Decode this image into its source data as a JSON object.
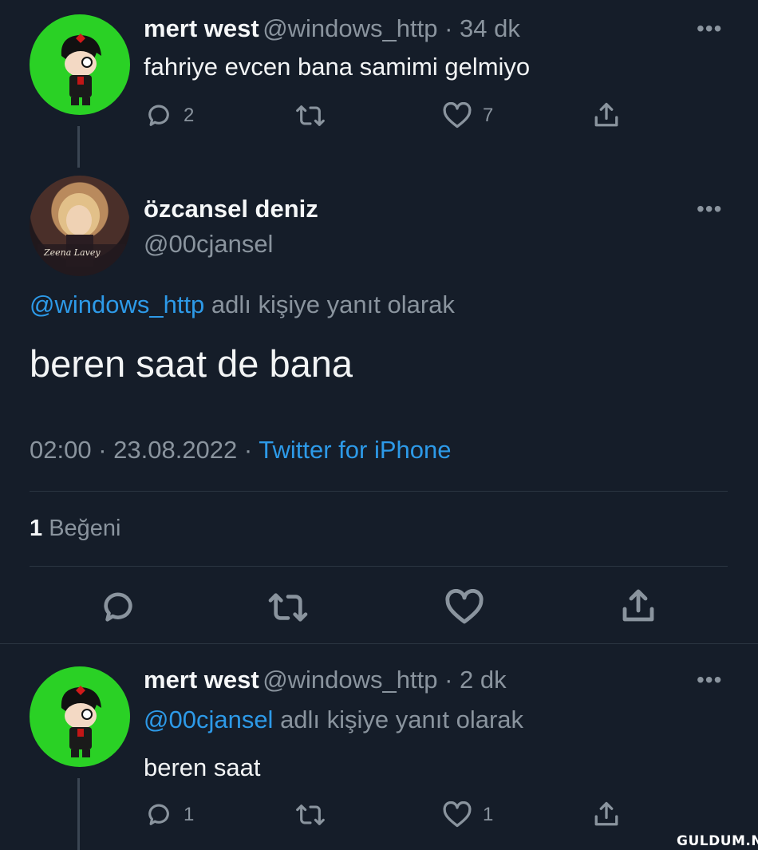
{
  "tweet1": {
    "name": "mert west",
    "handle_time": "@windows_http · 34 dk",
    "text": "fahriye evcen bana samimi gelmiyo",
    "reply_count": "2",
    "like_count": "7",
    "avatar_color": "#2ad125"
  },
  "main_tweet": {
    "name": "özcansel deniz",
    "handle": "@00cjansel",
    "reply_to_handle": "@windows_http",
    "reply_to_suffix": " adlı kişiye yanıt olarak",
    "text": "beren saat de bana",
    "timestamp": "02:00 · 23.08.2022 · ",
    "source": "Twitter for iPhone",
    "like_stat_count": "1",
    "like_stat_label": " Beğeni",
    "avatar_caption": "Zeena Lavey"
  },
  "tweet3": {
    "name": "mert west",
    "handle_time": "@windows_http · 2 dk",
    "reply_to_handle": "@00cjansel",
    "reply_to_suffix": " adlı kişiye yanıt olarak",
    "text": "beren saat",
    "reply_count": "1",
    "like_count": "1",
    "avatar_color": "#2ad125"
  },
  "more_glyph": "•••",
  "watermark": "GULDUM.NET",
  "colors": {
    "background": "#151d29",
    "link": "#2d9ae8",
    "muted": "#8a949e"
  }
}
